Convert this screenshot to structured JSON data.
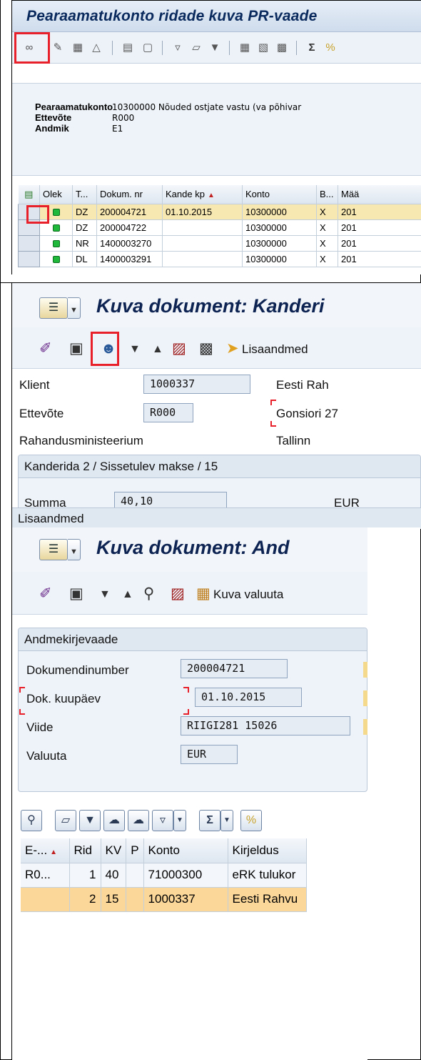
{
  "panel1": {
    "title": "Pearaamatukonto ridade kuva PR-vaade",
    "header": {
      "rows": [
        {
          "label": "Pearaamatukonto",
          "value": "10300000 Nõuded ostjate vastu (va põhivar"
        },
        {
          "label": "Ettevõte",
          "value": "R000"
        },
        {
          "label": "Andmik",
          "value": "E1"
        }
      ]
    },
    "table": {
      "columns": [
        "Olek",
        "T...",
        "Dokum. nr",
        "Kande kp",
        "Konto",
        "B...",
        "Mää"
      ],
      "rows": [
        {
          "type": "DZ",
          "doc": "200004721",
          "date": "01.10.2015",
          "account": "10300000",
          "b": "X",
          "m": "201"
        },
        {
          "type": "DZ",
          "doc": "200004722",
          "date": "",
          "account": "10300000",
          "b": "X",
          "m": "201"
        },
        {
          "type": "NR",
          "doc": "1400003270",
          "date": "",
          "account": "10300000",
          "b": "X",
          "m": "201"
        },
        {
          "type": "DL",
          "doc": "1400003291",
          "date": "",
          "account": "10300000",
          "b": "X",
          "m": "201"
        }
      ]
    }
  },
  "panel2": {
    "title": "Kuva dokument: Kanderi",
    "toolbar": {
      "extra_label": "Lisaandmed"
    },
    "fields": {
      "klient_label": "Klient",
      "klient_value": "1000337",
      "ettevote_label": "Ettevõte",
      "ettevote_value": "R000",
      "org_name": "Rahandusministeerium",
      "addr_name": "Eesti Rah",
      "addr_street": "Gonsiori 27",
      "addr_city": "Tallinn"
    },
    "group": {
      "title": "Kanderida 2 / Sissetulev makse / 15",
      "summa_label": "Summa",
      "summa_value": "40,10",
      "currency": "EUR"
    },
    "bottom_label": "Lisaandmed"
  },
  "panel3": {
    "title": "Kuva dokument: And",
    "toolbar": {
      "extra_label": "Kuva valuuta"
    },
    "group_title": "Andmekirjevaade",
    "fields": [
      {
        "label": "Dokumendinumber",
        "value": "200004721"
      },
      {
        "label": "Dok. kuupäev",
        "value": "01.10.2015"
      },
      {
        "label": "Viide",
        "value": "RIIGI281  15026"
      },
      {
        "label": "Valuuta",
        "value": "EUR"
      }
    ],
    "table": {
      "columns": [
        "E-...",
        "Rid",
        "KV",
        "P",
        "Konto",
        "Kirjeldus"
      ],
      "rows": [
        {
          "e": "R0...",
          "rid": "1",
          "kv": "40",
          "p": "",
          "konto": "71000300",
          "desc": "eRK tulukor"
        },
        {
          "e": "",
          "rid": "2",
          "kv": "15",
          "p": "",
          "konto": "1000337",
          "desc": "Eesti Rahvu"
        }
      ]
    }
  },
  "colors": {
    "highlight_red": "#e8202a",
    "selected_row": "#fbd79a",
    "title_blue": "#0d2352"
  }
}
